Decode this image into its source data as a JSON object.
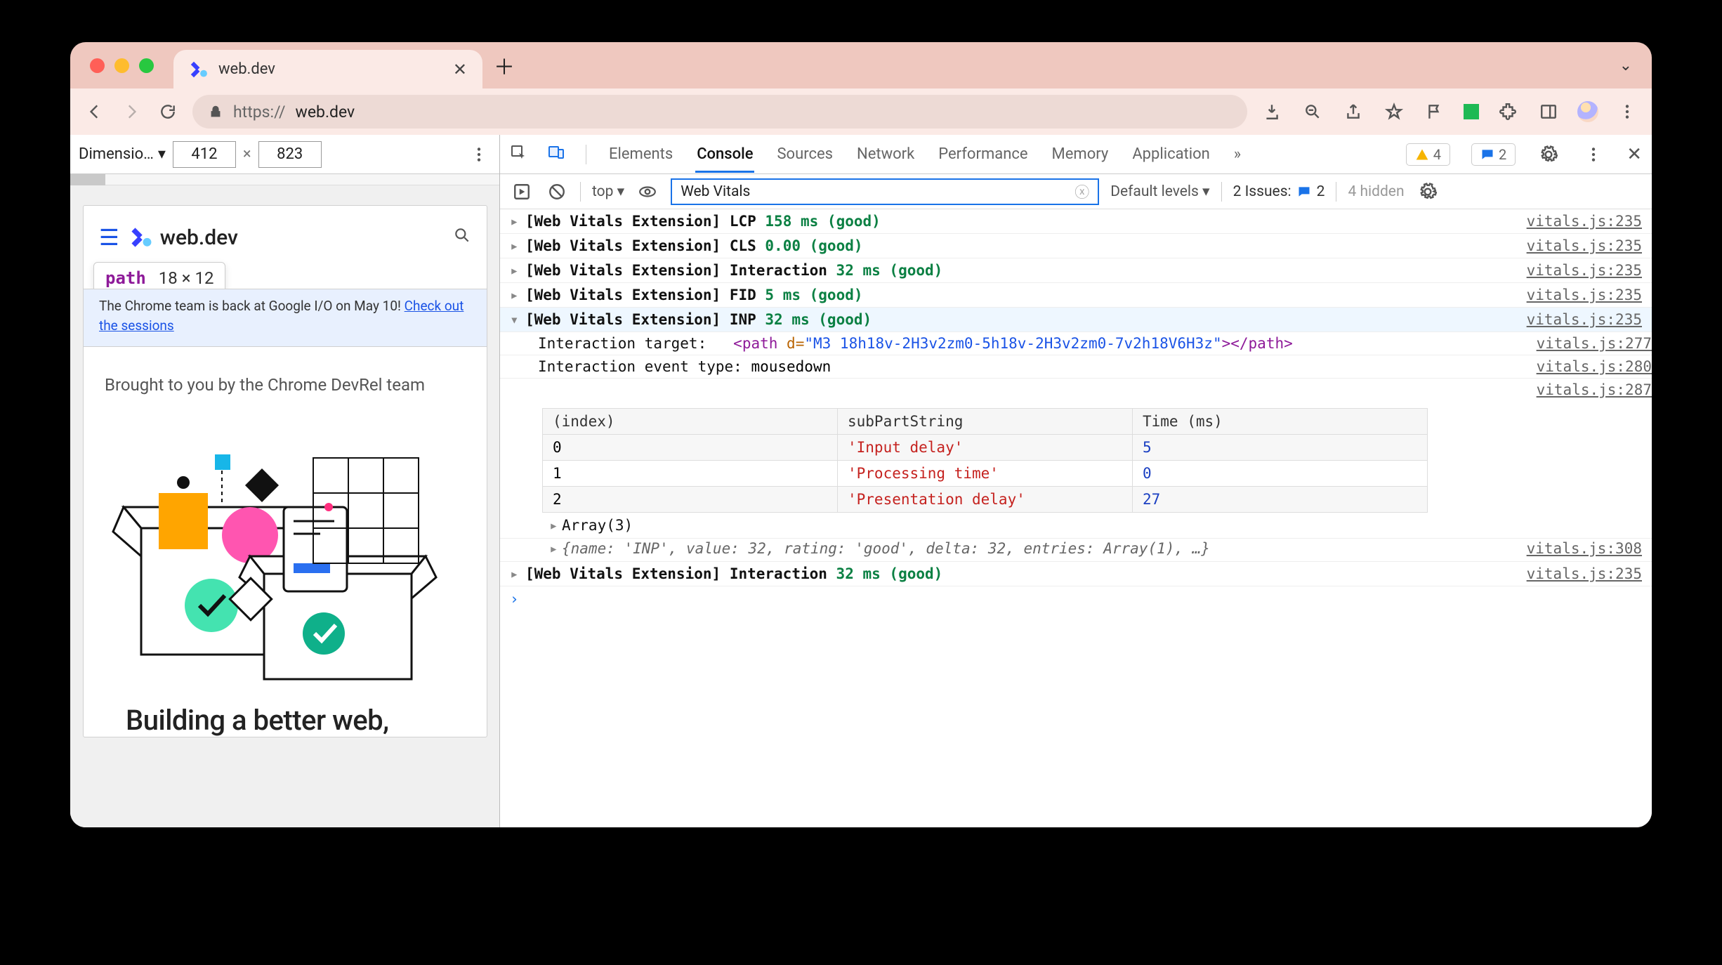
{
  "browser": {
    "tab_title": "web.dev",
    "url_scheme": "https://",
    "url_host": "web.dev"
  },
  "device_toolbar": {
    "label": "Dimensio…",
    "width": "412",
    "height": "823"
  },
  "page_preview": {
    "brand": "web.dev",
    "hover_tag": "path",
    "hover_dims": "18 × 12",
    "banner_pre": "The Chrome team is back at Google I/O on May 10! ",
    "banner_link": "Check out the sessions",
    "brought": "Brought to you by the Chrome DevRel team",
    "hero_title": "Building a better web,"
  },
  "devtools_tabs": [
    "Elements",
    "Console",
    "Sources",
    "Network",
    "Performance",
    "Memory",
    "Application"
  ],
  "devtools_active_tab": "Console",
  "devtools_overflow": "»",
  "warning_count": "4",
  "message_count": "2",
  "filterbar": {
    "context": "top",
    "filter_value": "Web Vitals",
    "levels": "Default levels",
    "issues_label": "2 Issues:",
    "issues_count": "2",
    "hidden": "4 hidden"
  },
  "logs": [
    {
      "metric": "LCP",
      "value": "158 ms",
      "status": "(good)",
      "src": "vitals.js:235",
      "open": false
    },
    {
      "metric": "CLS",
      "value": "0.00",
      "status": "(good)",
      "src": "vitals.js:235",
      "open": false
    },
    {
      "metric": "Interaction",
      "value": "32 ms",
      "status": "(good)",
      "src": "vitals.js:235",
      "open": false
    },
    {
      "metric": "FID",
      "value": "5 ms",
      "status": "(good)",
      "src": "vitals.js:235",
      "open": false
    }
  ],
  "log_expanded": {
    "metric": "INP",
    "value": "32 ms",
    "status": "(good)",
    "src": "vitals.js:235",
    "target_label": "Interaction target:",
    "target_tag": "path",
    "target_attr": "d",
    "target_val": "\"M3 18h18v-2H3v2zm0-5h18v-2H3v2zm0-7v2h18V6H3z\"",
    "target_src": "vitals.js:277",
    "event_label": "Interaction event type:",
    "event_value": "mousedown",
    "event_src": "vitals.js:280",
    "table_src": "vitals.js:287",
    "table_headers": [
      "(index)",
      "subPartString",
      "Time (ms)"
    ],
    "table_rows": [
      {
        "i": "0",
        "s": "'Input delay'",
        "t": "5"
      },
      {
        "i": "1",
        "s": "'Processing time'",
        "t": "0"
      },
      {
        "i": "2",
        "s": "'Presentation delay'",
        "t": "27"
      }
    ],
    "array_label": "Array(3)",
    "object_repr": "{name: 'INP', value: 32, rating: 'good', delta: 32, entries: Array(1), …}",
    "object_src": "vitals.js:308"
  },
  "log_last": {
    "metric": "Interaction",
    "value": "32 ms",
    "status": "(good)",
    "src": "vitals.js:235"
  },
  "log_prefix": "[Web Vitals Extension]"
}
